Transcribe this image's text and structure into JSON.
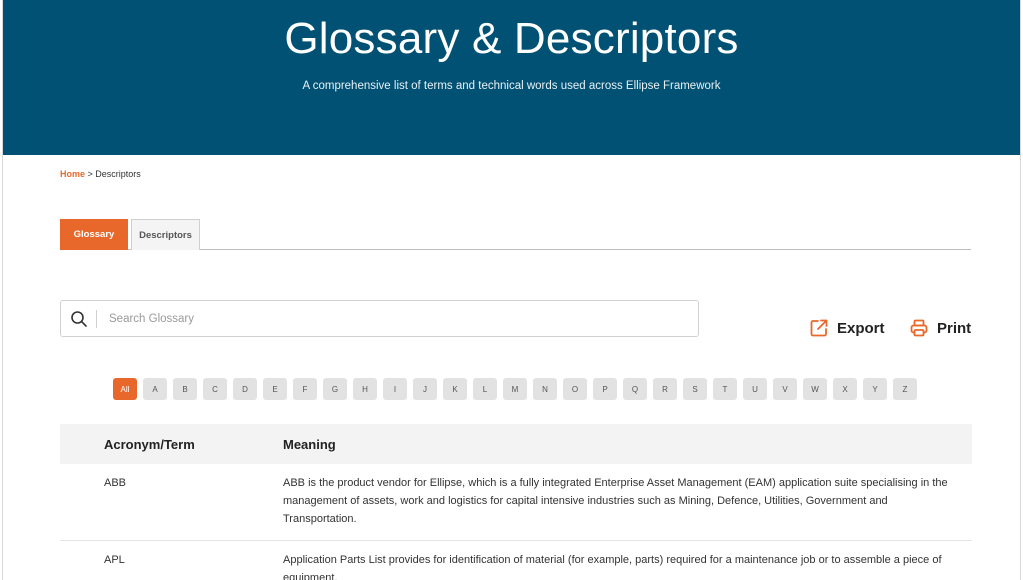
{
  "header": {
    "title": "Glossary & Descriptors",
    "subtitle": "A comprehensive list of terms and technical words used across Ellipse Framework"
  },
  "breadcrumb": {
    "home": "Home",
    "separator": " > ",
    "current": "Descriptors"
  },
  "tabs": [
    {
      "label": "Glossary",
      "active": true
    },
    {
      "label": "Descriptors",
      "active": false
    }
  ],
  "search": {
    "placeholder": "Search Glossary",
    "value": ""
  },
  "actions": {
    "export_label": "Export",
    "print_label": "Print"
  },
  "alphabet": [
    "All",
    "A",
    "B",
    "C",
    "D",
    "E",
    "F",
    "G",
    "H",
    "I",
    "J",
    "K",
    "L",
    "M",
    "N",
    "O",
    "P",
    "Q",
    "R",
    "S",
    "T",
    "U",
    "V",
    "W",
    "X",
    "Y",
    "Z"
  ],
  "alphabet_selected": "All",
  "table": {
    "columns": [
      "Acronym/Term",
      "Meaning"
    ],
    "rows": [
      {
        "term": "ABB",
        "meaning": "ABB is the product vendor for Ellipse, which is a fully integrated Enterprise Asset Management (EAM) application suite specialising in the management of assets, work and logistics for capital intensive industries such as Mining, Defence, Utilities, Government and Transportation."
      },
      {
        "term": "APL",
        "meaning": "Application Parts List provides for identification of material (for example, parts) required for a maintenance job or to assemble a piece of equipment."
      }
    ]
  },
  "colors": {
    "header_bg": "#005173",
    "accent": "#e8682b"
  }
}
